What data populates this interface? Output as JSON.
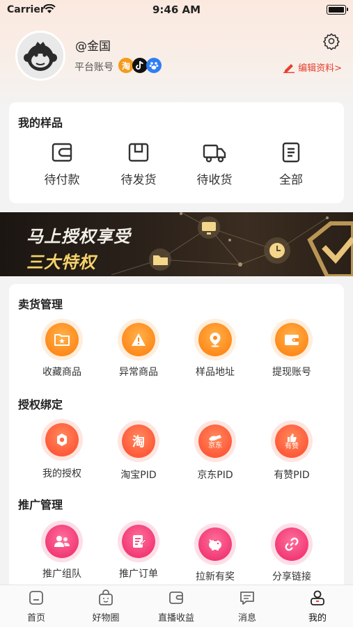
{
  "status_bar": {
    "carrier": "Carrier",
    "time": "9:46 AM"
  },
  "profile": {
    "username": "@金国",
    "account_label": "平台账号",
    "platform_icons": [
      "taobao-icon",
      "douyin-icon",
      "baidu-icon"
    ],
    "edit_label": "编辑资料>"
  },
  "samples": {
    "title": "我的样品",
    "items": [
      {
        "label": "待付款",
        "icon": "wallet-icon"
      },
      {
        "label": "待发货",
        "icon": "box-icon"
      },
      {
        "label": "待收货",
        "icon": "truck-icon"
      },
      {
        "label": "全部",
        "icon": "list-icon"
      }
    ]
  },
  "banner": {
    "line1": "马上授权享受",
    "line2": "三大特权"
  },
  "sales": {
    "title": "卖货管理",
    "items": [
      {
        "label": "收藏商品",
        "icon": "folder-icon"
      },
      {
        "label": "异常商品",
        "icon": "warning-icon"
      },
      {
        "label": "样品地址",
        "icon": "location-icon"
      },
      {
        "label": "提现账号",
        "icon": "wallet-icon"
      }
    ]
  },
  "auth": {
    "title": "授权绑定",
    "items": [
      {
        "label": "我的授权",
        "icon": "authorize-icon"
      },
      {
        "label": "淘宝PID",
        "icon": "taobao-icon",
        "glyph": "淘"
      },
      {
        "label": "京东PID",
        "icon": "jd-icon",
        "glyph": "京东"
      },
      {
        "label": "有赞PID",
        "icon": "youzan-icon",
        "glyph": "有赞"
      }
    ]
  },
  "promo": {
    "title": "推广管理",
    "items": [
      {
        "label": "推广组队",
        "icon": "team-icon"
      },
      {
        "label": "推广订单",
        "icon": "order-icon"
      },
      {
        "label": "拉新有奖",
        "icon": "piggy-bank-icon"
      },
      {
        "label": "分享链接",
        "icon": "link-icon"
      }
    ]
  },
  "tabbar": {
    "items": [
      {
        "label": "首页",
        "icon": "home-icon"
      },
      {
        "label": "好物圈",
        "icon": "bag-icon"
      },
      {
        "label": "直播收益",
        "icon": "earnings-icon"
      },
      {
        "label": "消息",
        "icon": "message-icon"
      },
      {
        "label": "我的",
        "icon": "user-icon",
        "active": true
      }
    ]
  },
  "colors": {
    "accent_red": "#e6402f",
    "orange": "#ff8a1c",
    "pink": "#f23a76",
    "banner_gold": "#f5d36b"
  }
}
